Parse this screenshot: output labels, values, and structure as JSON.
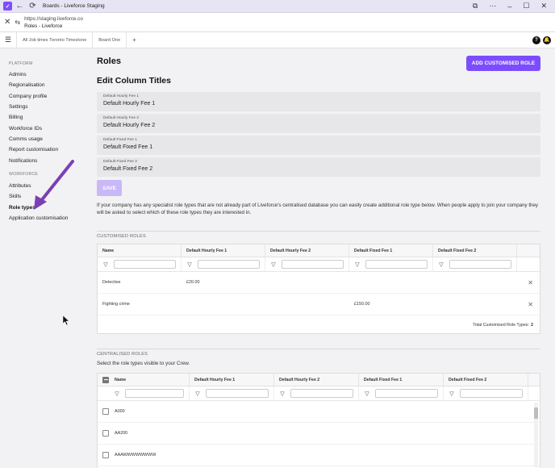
{
  "window": {
    "title": "Boards - Liveforce Staging"
  },
  "url": {
    "line1": "https://staging.liveforce.co",
    "line2": "Roles - Liveforce"
  },
  "topnav": {
    "tabs": [
      "All Job times Toronto Timestone",
      "Board One"
    ],
    "plus": "+",
    "help": "?",
    "bell": "●"
  },
  "sidebar": {
    "platform_label": "PLATFORM",
    "platform_items": [
      "Admins",
      "Regionalisation",
      "Company profile",
      "Settings",
      "Billing",
      "Workforce IDs",
      "Comms usage",
      "Report customisation",
      "Notifications"
    ],
    "workforce_label": "WORKFORCE",
    "workforce_items": [
      "Attributes",
      "Skills",
      "Role types",
      "Application customisation"
    ]
  },
  "page": {
    "title": "Roles",
    "add_button": "ADD CUSTOMISED ROLE",
    "edit_title": "Edit Column Titles",
    "fields": [
      {
        "label": "Default Hourly Fee 1",
        "value": "Default Hourly Fee 1"
      },
      {
        "label": "Default Hourly Fee 2",
        "value": "Default Hourly Fee 2"
      },
      {
        "label": "Default Fixed Fee 1",
        "value": "Default Fixed Fee 1"
      },
      {
        "label": "Default Fixed Fee 2",
        "value": "Default Fixed Fee 2"
      }
    ],
    "save_button": "SAVE",
    "info": "If your company has any specialist role types that are not already part of Liveforce's centralised database you can easily create additional role type below. When people apply to join your company they will be asked to select which of these role types they are interested in."
  },
  "customised": {
    "label": "CUSTOMISED ROLES",
    "columns": [
      "Name",
      "Default Hourly Fee 1",
      "Default Hourly Fee 2",
      "Default Fixed Fee 1",
      "Default Fixed Fee 2"
    ],
    "rows": [
      {
        "name": "Detective",
        "hourly1": "£20.00",
        "hourly2": "",
        "fixed1": "",
        "fixed2": ""
      },
      {
        "name": "Fighting crime",
        "hourly1": "",
        "hourly2": "",
        "fixed1": "£150.00",
        "fixed2": ""
      }
    ],
    "total_label": "Total Customised Role Types:",
    "total_value": "2"
  },
  "centralised": {
    "label": "CENTRALISED ROLES",
    "subtitle": "Select the role types visible to your Crew.",
    "columns": [
      "Name",
      "Default Hourly Fee 1",
      "Default Hourly Fee 2",
      "Default Fixed Fee 1",
      "Default Fixed Fee 2"
    ],
    "rows": [
      "A000",
      "AA200",
      "AAAWWWWWWWW"
    ]
  }
}
